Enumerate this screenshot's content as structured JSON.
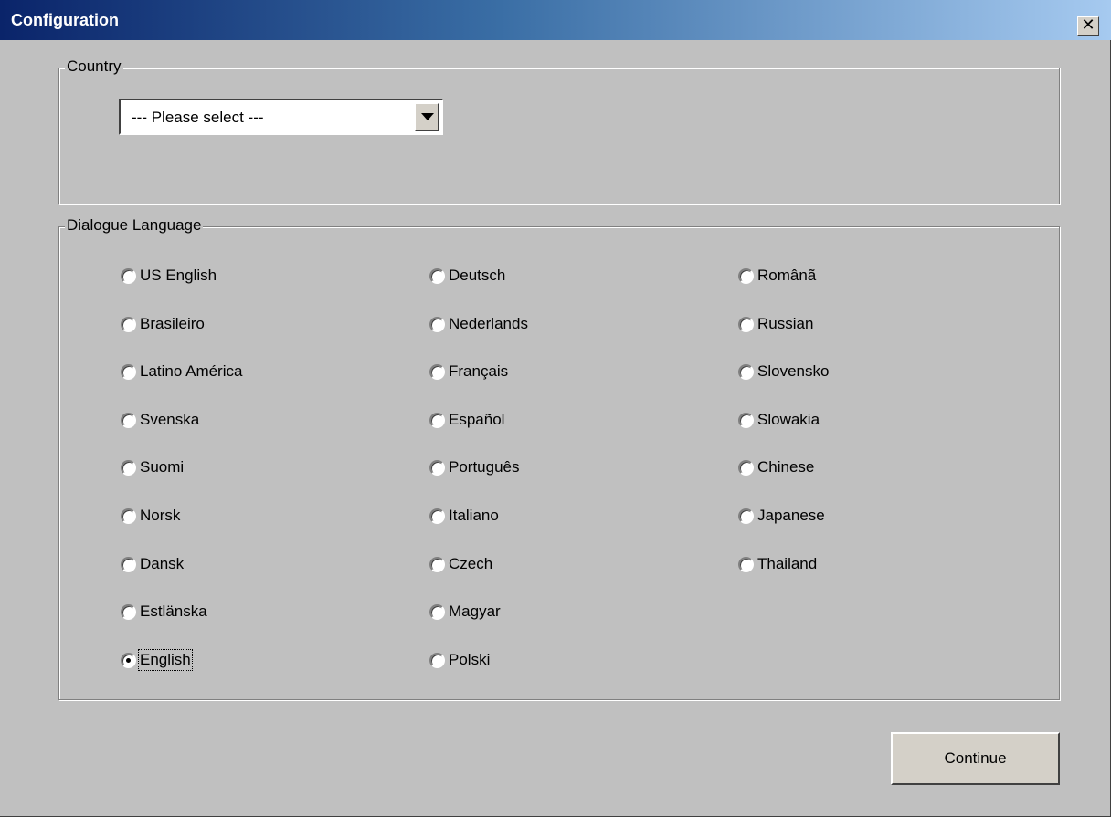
{
  "window": {
    "title": "Configuration",
    "close_glyph": "✕"
  },
  "country": {
    "legend": "Country",
    "select_value": "--- Please select ---"
  },
  "language": {
    "legend": "Dialogue Language",
    "selected": "English",
    "columns": [
      [
        "US English",
        "Brasileiro",
        "Latino América",
        "Svenska",
        "Suomi",
        "Norsk",
        "Dansk",
        "Estlänska",
        "English"
      ],
      [
        "Deutsch",
        "Nederlands",
        "Français",
        "Español",
        "Português",
        "Italiano",
        "Czech",
        "Magyar",
        "Polski"
      ],
      [
        "Românã",
        "Russian",
        "Slovensko",
        "Slowakia",
        "Chinese",
        "Japanese",
        "Thailand"
      ]
    ]
  },
  "buttons": {
    "continue_label": "Continue"
  },
  "colors": {
    "title_start": "#0a246a",
    "title_end": "#a6caf0",
    "face": "#c0c0c0"
  }
}
